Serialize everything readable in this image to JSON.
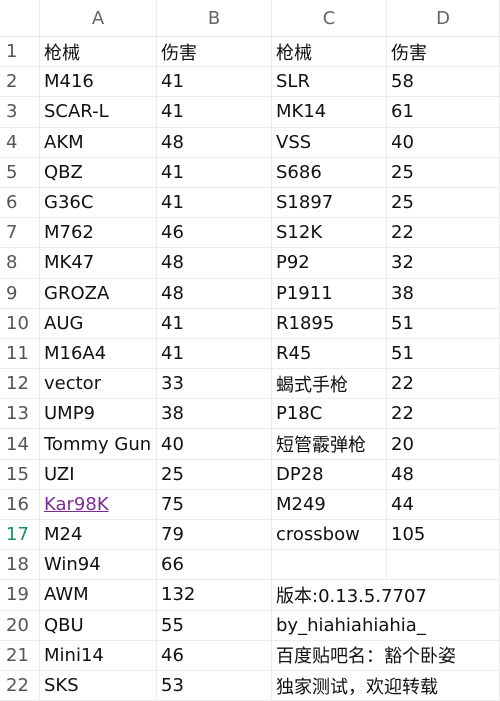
{
  "columns": [
    "A",
    "B",
    "C",
    "D"
  ],
  "rows": [
    {
      "n": "1",
      "a": "枪械",
      "b": "伤害",
      "c": "枪械",
      "d": "伤害"
    },
    {
      "n": "2",
      "a": "M416",
      "b": "41",
      "c": "SLR",
      "d": "58"
    },
    {
      "n": "3",
      "a": "SCAR-L",
      "b": "41",
      "c": "MK14",
      "d": "61"
    },
    {
      "n": "4",
      "a": "AKM",
      "b": "48",
      "c": "VSS",
      "d": "40"
    },
    {
      "n": "5",
      "a": "QBZ",
      "b": "41",
      "c": "S686",
      "d": "25"
    },
    {
      "n": "6",
      "a": "G36C",
      "b": "41",
      "c": "S1897",
      "d": "25"
    },
    {
      "n": "7",
      "a": "M762",
      "b": "46",
      "c": "S12K",
      "d": "22"
    },
    {
      "n": "8",
      "a": "MK47",
      "b": "48",
      "c": "P92",
      "d": "32"
    },
    {
      "n": "9",
      "a": "GROZA",
      "b": "48",
      "c": "P1911",
      "d": "38"
    },
    {
      "n": "10",
      "a": "AUG",
      "b": "41",
      "c": "R1895",
      "d": "51"
    },
    {
      "n": "11",
      "a": "M16A4",
      "b": "41",
      "c": "R45",
      "d": "51"
    },
    {
      "n": "12",
      "a": "vector",
      "b": "33",
      "c": "蝎式手枪",
      "d": "22"
    },
    {
      "n": "13",
      "a": "UMP9",
      "b": "38",
      "c": "P18C",
      "d": "22"
    },
    {
      "n": "14",
      "a": "Tommy Gun",
      "b": "40",
      "c": "短管霰弹枪",
      "d": "20"
    },
    {
      "n": "15",
      "a": "UZI",
      "b": "25",
      "c": "DP28",
      "d": "48"
    },
    {
      "n": "16",
      "a": "Kar98K",
      "b": "75",
      "c": "M249",
      "d": "44",
      "a_link": true
    },
    {
      "n": "17",
      "a": "M24",
      "b": "79",
      "c": "crossbow",
      "d": "105",
      "selected": true
    },
    {
      "n": "18",
      "a": "Win94",
      "b": "66",
      "c": "",
      "d": ""
    },
    {
      "n": "19",
      "a": "AWM",
      "b": "132",
      "cd": "版本:0.13.5.7707"
    },
    {
      "n": "20",
      "a": "QBU",
      "b": "55",
      "cd": "by_hiahiahiahia_"
    },
    {
      "n": "21",
      "a": "Mini14",
      "b": "46",
      "cd": "百度贴吧名：豁个卧姿"
    },
    {
      "n": "22",
      "a": "SKS",
      "b": "53",
      "cd": "独家测试，欢迎转载"
    }
  ],
  "colors": {
    "link": "#7b2d8e",
    "selected_row_number": "#1a8a6a"
  }
}
